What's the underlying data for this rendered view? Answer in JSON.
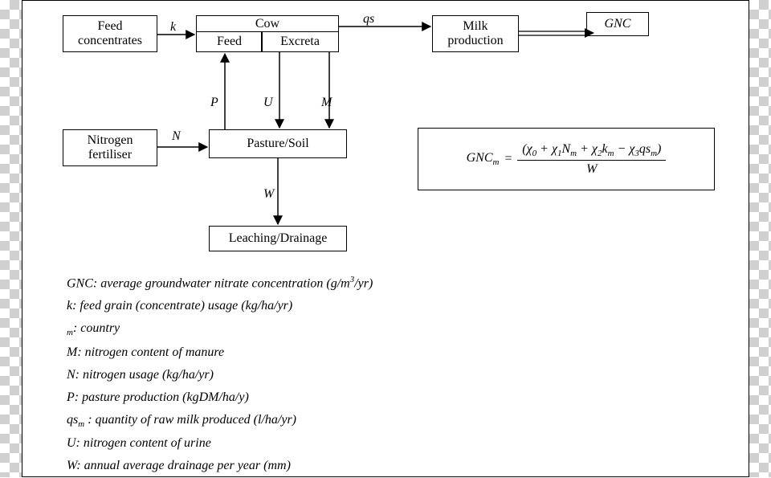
{
  "boxes": {
    "feed_concentrates": "Feed\nconcentrates",
    "cow": "Cow",
    "cow_feed": "Feed",
    "cow_excreta": "Excreta",
    "milk_production": "Milk\nproduction",
    "gnc": "GNC",
    "nitrogen_fertiliser": "Nitrogen\nfertiliser",
    "pasture_soil": "Pasture/Soil",
    "leaching_drainage": "Leaching/Drainage"
  },
  "edge_labels": {
    "k": "k",
    "qs": "qs",
    "P": "P",
    "U": "U",
    "M": "M",
    "N": "N",
    "W": "W"
  },
  "formula": {
    "lhs_var": "GNC",
    "lhs_sub": "m",
    "num_terms": {
      "chi0": "χ",
      "chi0_sub": "0",
      "chi1": "χ",
      "chi1_sub": "1",
      "N": "N",
      "N_sub": "m",
      "chi2": "χ",
      "chi2_sub": "2",
      "k": "k",
      "k_sub": "m",
      "chi3": "χ",
      "chi3_sub": "3",
      "qs": "qs",
      "qs_sub": "m"
    },
    "den": "W"
  },
  "legend": {
    "l1a": "GNC: average groundwater nitrate concentration (g/m",
    "l1b": "/yr)",
    "l1_sup": "3",
    "l2": "k: feed grain (concentrate) usage (kg/ha/yr)",
    "l3_sub": "m",
    "l3b": ": country",
    "l4": "M: nitrogen content of manure",
    "l5": "N: nitrogen usage (kg/ha/yr)",
    "l6": "P: pasture production (kgDM/ha/y)",
    "l7a": "qs",
    "l7_sub": "m",
    "l7b": " : quantity of raw milk produced (l/ha/yr)",
    "l8": "U: nitrogen content of urine",
    "l9": "W: annual average drainage per year (mm)"
  }
}
